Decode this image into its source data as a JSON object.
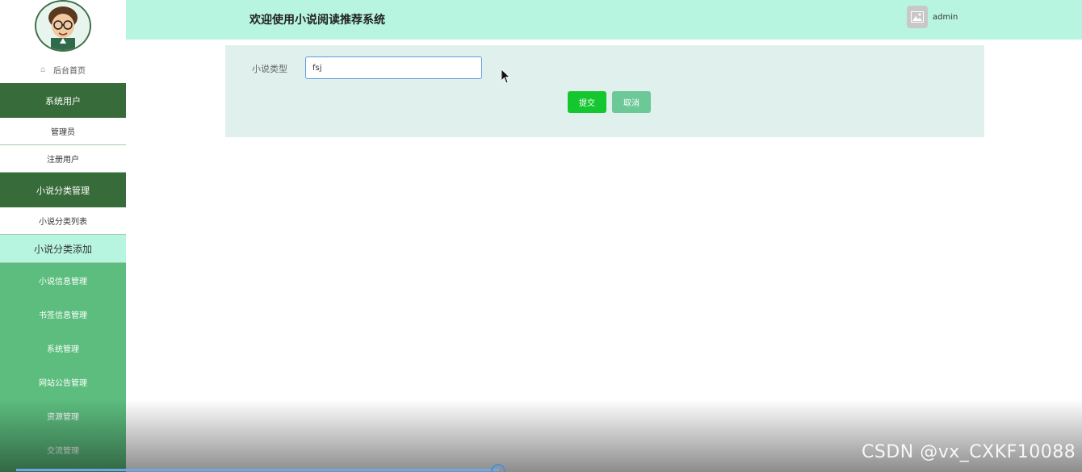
{
  "sidebar": {
    "home": "后台首页",
    "groups": [
      {
        "header": "系统用户",
        "items": [
          "管理员",
          "注册用户"
        ]
      },
      {
        "header": "小说分类管理",
        "items": [
          "小说分类列表",
          "小说分类添加"
        ]
      }
    ],
    "menu": [
      "小说信息管理",
      "书签信息管理",
      "系统管理",
      "网站公告管理",
      "资源管理",
      "交流管理"
    ]
  },
  "topbar": {
    "title": "欢迎使用小说阅读推荐系统",
    "username": "admin"
  },
  "form": {
    "label": "小说类型",
    "value": "fsj",
    "submit": "提交",
    "cancel": "取消"
  },
  "watermark": "CSDN @vx_CXKF10088",
  "colors": {
    "sidebar": "#5cbd7e",
    "sidebar_header": "#386b3a",
    "topbar": "#b8f5e1",
    "panel": "#dff0ed",
    "submit": "#14c62f",
    "cancel": "#6cc897"
  },
  "video_progress": 0.46
}
